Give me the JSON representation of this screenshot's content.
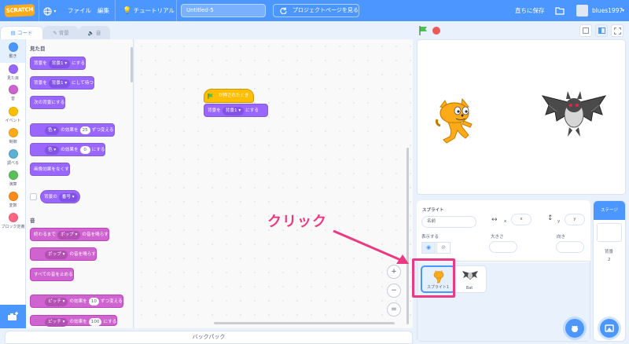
{
  "menubar": {
    "logo": "SCRATCH",
    "file": "ファイル",
    "edit": "編集",
    "tutorials": "チュートリアル",
    "project_title": "Untitled-5",
    "project_page": "プロジェクトページを見る",
    "save_now": "直ちに保存",
    "username": "blues1997"
  },
  "tabs": {
    "code": "コード",
    "costumes": "背景",
    "sounds": "音"
  },
  "categories": [
    {
      "label": "動き",
      "color": "#4c97ff"
    },
    {
      "label": "見た目",
      "color": "#9966ff"
    },
    {
      "label": "音",
      "color": "#cf63cf"
    },
    {
      "label": "イベント",
      "color": "#ffbf00"
    },
    {
      "label": "制御",
      "color": "#ffab19"
    },
    {
      "label": "調べる",
      "color": "#5cb1d6"
    },
    {
      "label": "演算",
      "color": "#59c059"
    },
    {
      "label": "変数",
      "color": "#ff8c1a"
    },
    {
      "label": "ブロック定義",
      "color": "#ff6680"
    }
  ],
  "palette": {
    "looks_heading": "見た目",
    "b1_a": "背景を",
    "b1_dd": "背景1",
    "b1_b": "にする",
    "b2_a": "背景を",
    "b2_dd": "背景1",
    "b2_b": "にして待つ",
    "b3": "次の背景にする",
    "b4_dd": "色",
    "b4_a": "の効果を",
    "b4_n": "25",
    "b4_b": "ずつ変える",
    "b5_dd": "色",
    "b5_a": "の効果を",
    "b5_n": "0",
    "b5_b": "にする",
    "b6": "画像効果をなくす",
    "b7_a": "背景の",
    "b7_dd": "番号",
    "sound_heading": "音",
    "s1_a": "終わるまで",
    "s1_dd": "ポップ",
    "s1_b": "の音を鳴らす",
    "s2_dd": "ポップ",
    "s2_b": "の音を鳴らす",
    "s3": "すべての音を止める",
    "s4_dd": "ピッチ",
    "s4_a": "の効果を",
    "s4_n": "10",
    "s4_b": "ずつ変える",
    "s5_dd": "ピッチ",
    "s5_a": "の効果を",
    "s5_n": "100",
    "s5_b": "にする"
  },
  "script": {
    "hat": "が押されたとき",
    "block_a": "背景を",
    "block_dd": "背景1",
    "block_b": "にする"
  },
  "zoom": {
    "in": "+",
    "out": "−",
    "reset": "="
  },
  "backpack": "バックパック",
  "sprite_info": {
    "sprite_label": "スプライト",
    "name_placeholder": "名前",
    "x_label": "x",
    "x_placeholder": "x",
    "y_label": "y",
    "y_placeholder": "y",
    "show_label": "表示する",
    "size_label": "大きさ",
    "direction_label": "向き"
  },
  "sprites": [
    {
      "name": "スプライト1",
      "selected": true
    },
    {
      "name": "Bat",
      "selected": false
    }
  ],
  "stage_pane": {
    "title": "ステージ",
    "backdrops_label": "背景",
    "backdrops_count": "2"
  },
  "annotation": {
    "text": "クリック",
    "color": "#ec3a82"
  },
  "colors": {
    "accent": "#4c97ff",
    "looks": "#9966ff",
    "sound": "#cf63cf",
    "events": "#ffbf00",
    "annotation": "#ec3a82"
  }
}
